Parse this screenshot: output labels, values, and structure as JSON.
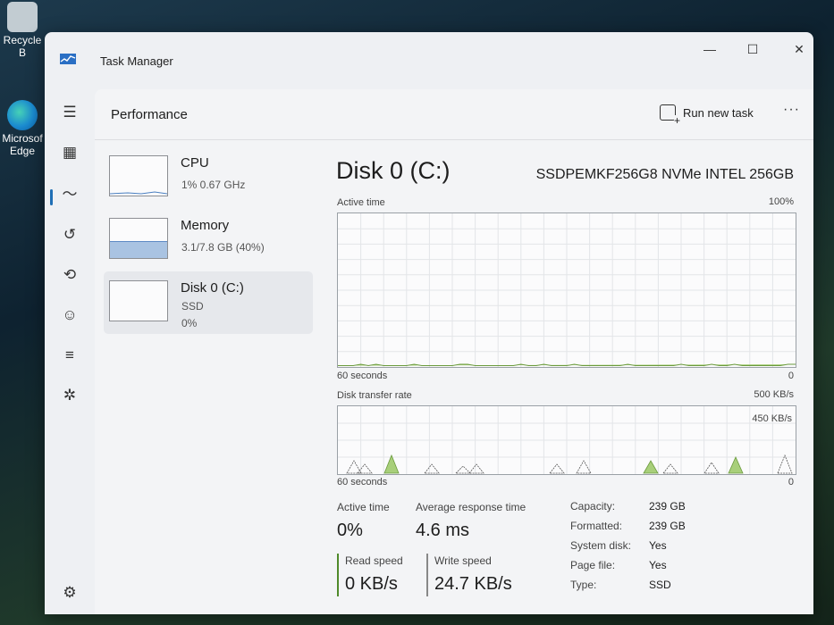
{
  "desktop": {
    "recycle_label": "Recycle B",
    "edge_label_1": "Microsof",
    "edge_label_2": "Edge"
  },
  "window": {
    "title": "Task Manager",
    "controls": {
      "minimize": "—",
      "maximize": "☐",
      "close": "✕"
    }
  },
  "nav": {
    "hamburger": "☰",
    "items": [
      {
        "name": "processes",
        "glyph": "▦"
      },
      {
        "name": "performance",
        "glyph": "〜"
      },
      {
        "name": "app-history",
        "glyph": "↺"
      },
      {
        "name": "startup-apps",
        "glyph": "⟲"
      },
      {
        "name": "users",
        "glyph": "☺"
      },
      {
        "name": "details",
        "glyph": "≡"
      },
      {
        "name": "services",
        "glyph": "✲"
      }
    ],
    "settings": "⚙"
  },
  "header": {
    "title": "Performance",
    "run_new_task": "Run new task",
    "more": "···"
  },
  "perf_list": [
    {
      "name": "CPU",
      "sub1": "1%  0.67 GHz",
      "sub2": "",
      "usage": 0.01
    },
    {
      "name": "Memory",
      "sub1": "3.1/7.8 GB (40%)",
      "sub2": "",
      "usage": 0.4
    },
    {
      "name": "Disk 0 (C:)",
      "sub1": "SSD",
      "sub2": "0%",
      "usage": 0.0
    }
  ],
  "detail": {
    "title": "Disk 0 (C:)",
    "model": "SSDPEMKF256G8 NVMe INTEL 256GB",
    "active_graph": {
      "label": "Active time",
      "max_label": "100%",
      "left_label": "60 seconds",
      "right_label": "0"
    },
    "transfer_graph": {
      "label": "Disk transfer rate",
      "max_label": "500 KB/s",
      "inner_label": "450 KB/s",
      "left_label": "60 seconds",
      "right_label": "0"
    },
    "stats": {
      "active_time_label": "Active time",
      "active_time_value": "0%",
      "avg_response_label": "Average response time",
      "avg_response_value": "4.6 ms",
      "read_label": "Read speed",
      "read_value": "0 KB/s",
      "write_label": "Write speed",
      "write_value": "24.7 KB/s"
    },
    "properties": [
      {
        "label": "Capacity:",
        "value": "239 GB"
      },
      {
        "label": "Formatted:",
        "value": "239 GB"
      },
      {
        "label": "System disk:",
        "value": "Yes"
      },
      {
        "label": "Page file:",
        "value": "Yes"
      },
      {
        "label": "Type:",
        "value": "SSD"
      }
    ]
  },
  "colors": {
    "disk_line": "#6a9a3c",
    "disk_fill": "#a8cf7a",
    "read_color": "#4f8a2a",
    "write_color": "#888888",
    "memory_fill": "#a9c3e2"
  }
}
